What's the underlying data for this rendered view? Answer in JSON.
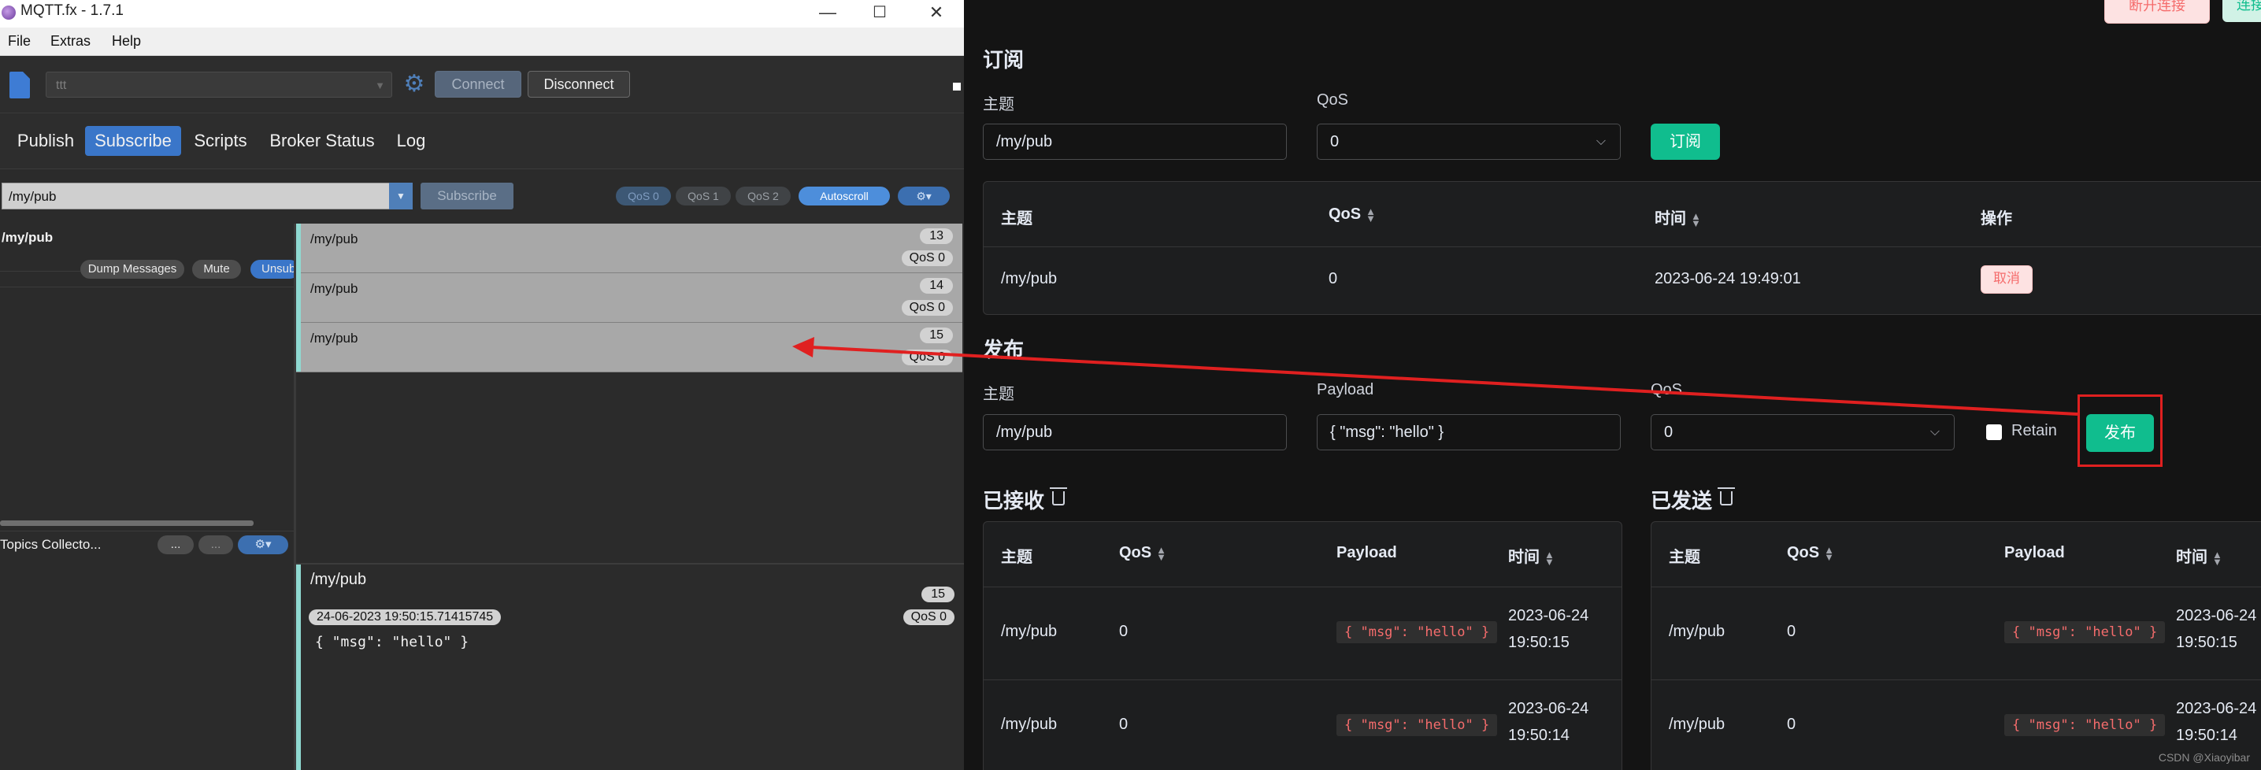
{
  "mqttfx": {
    "title": "MQTT.fx - 1.7.1",
    "window_controls": {
      "minimize": "—",
      "maximize": "☐",
      "close": "✕"
    },
    "menu": [
      "File",
      "Extras",
      "Help"
    ],
    "toolbar": {
      "profile": "ttt",
      "connect": "Connect",
      "disconnect": "Disconnect"
    },
    "tabs": [
      "Publish",
      "Subscribe",
      "Scripts",
      "Broker Status",
      "Log"
    ],
    "active_tab": "Subscribe",
    "subscribe_bar": {
      "topic": "/my/pub",
      "subscribe": "Subscribe",
      "qos": [
        "QoS 0",
        "QoS 1",
        "QoS 2"
      ],
      "autoscroll": "Autoscroll",
      "options_icon": "⚙▾"
    },
    "subscription": {
      "topic": "/my/pub",
      "dump": "Dump Messages",
      "mute": "Mute",
      "unsub": "Unsub"
    },
    "topics_collector": {
      "label": "Topics Collecto...",
      "btn1": "...",
      "btn2": "...",
      "options_icon": "⚙▾"
    },
    "messages": [
      {
        "topic": "/my/pub",
        "num": "13",
        "qos": "QoS 0"
      },
      {
        "topic": "/my/pub",
        "num": "14",
        "qos": "QoS 0"
      },
      {
        "topic": "/my/pub",
        "num": "15",
        "qos": "QoS 0"
      }
    ],
    "detail": {
      "topic": "/my/pub",
      "num": "15",
      "timestamp": "24-06-2023  19:50:15.71415745",
      "qos": "QoS 0",
      "payload": "{ \"msg\": \"hello\" }"
    }
  },
  "web": {
    "header_buttons": {
      "disconnect": "断开连接",
      "connect": "连接"
    },
    "subscribe": {
      "title": "订阅",
      "topic_label": "主题",
      "qos_label": "QoS",
      "topic_value": "/my/pub",
      "qos_value": "0",
      "button": "订阅",
      "table": {
        "headers": [
          "主题",
          "QoS",
          "时间",
          "操作"
        ],
        "rows": [
          {
            "topic": "/my/pub",
            "qos": "0",
            "time": "2023-06-24 19:49:01",
            "action": "取消"
          }
        ]
      }
    },
    "publish": {
      "title": "发布",
      "topic_label": "主题",
      "payload_label": "Payload",
      "qos_label": "QoS",
      "topic_value": "/my/pub",
      "payload_value": "{ \"msg\": \"hello\" }",
      "qos_value": "0",
      "retain_label": "Retain",
      "button": "发布"
    },
    "received": {
      "title": "已接收",
      "headers": [
        "主题",
        "QoS",
        "Payload",
        "时间"
      ],
      "rows": [
        {
          "topic": "/my/pub",
          "qos": "0",
          "payload": "{ \"msg\": \"hello\" }",
          "date": "2023-06-24",
          "time": "19:50:15"
        },
        {
          "topic": "/my/pub",
          "qos": "0",
          "payload": "{ \"msg\": \"hello\" }",
          "date": "2023-06-24",
          "time": "19:50:14"
        }
      ]
    },
    "sent": {
      "title": "已发送",
      "headers": [
        "主题",
        "QoS",
        "Payload",
        "时间"
      ],
      "rows": [
        {
          "topic": "/my/pub",
          "qos": "0",
          "payload": "{ \"msg\": \"hello\" }",
          "date": "2023-06-24",
          "time": "19:50:15"
        },
        {
          "topic": "/my/pub",
          "qos": "0",
          "payload": "{ \"msg\": \"hello\" }",
          "date": "2023-06-24",
          "time": "19:50:14"
        }
      ]
    },
    "watermark": "CSDN @Xiaoyibar"
  },
  "colors": {
    "accent_blue": "#3a76c9",
    "primary_green": "#10bd8e",
    "danger_red": "#f56c6c",
    "annotation_red": "#e02020"
  }
}
